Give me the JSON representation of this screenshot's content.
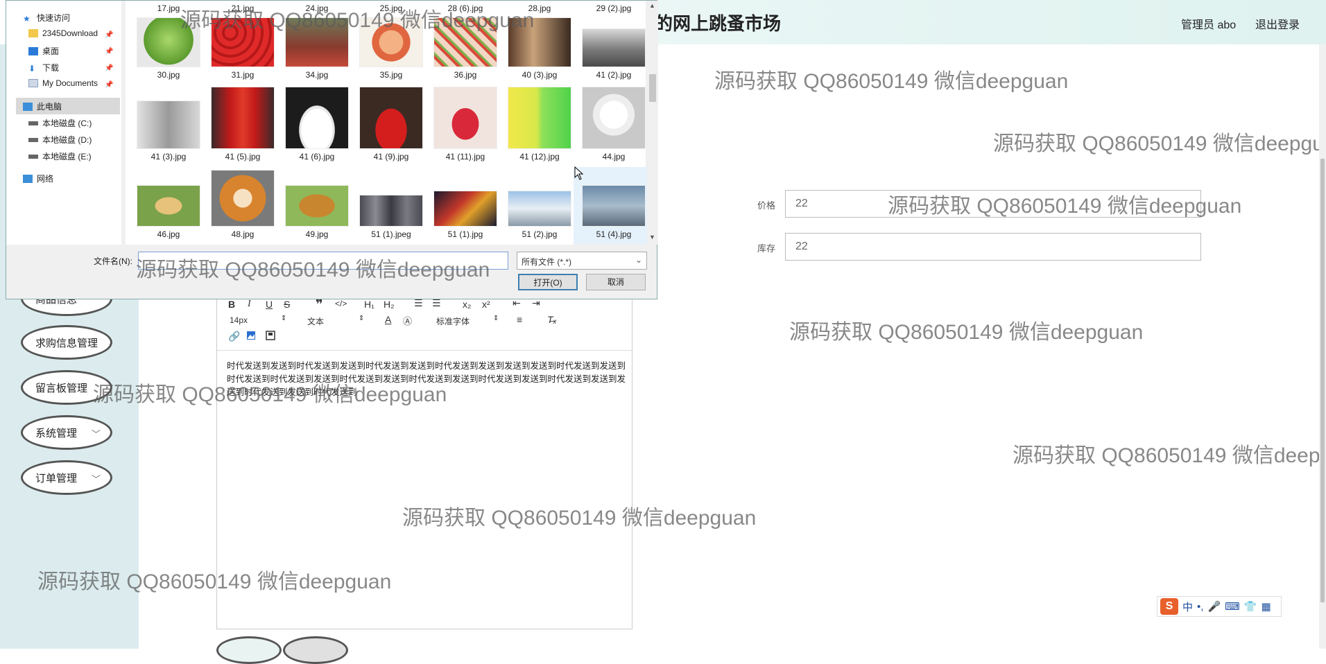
{
  "header": {
    "title": "的网上跳蚤市场",
    "user": "管理员 abo",
    "logout": "退出登录"
  },
  "sidebar": {
    "items": [
      {
        "label": "商品信息"
      },
      {
        "label": "求购信息管理"
      },
      {
        "label": "留言板管理"
      },
      {
        "label": "系统管理"
      },
      {
        "label": "订单管理"
      }
    ]
  },
  "form": {
    "price_label": "价格",
    "price_value": "22",
    "stock_label": "库存",
    "stock_value": "22"
  },
  "editor": {
    "font_size": "14px",
    "paragraph": "文本",
    "font_family": "标准字体",
    "content": "时代发送到发送到时代发送到发送到时代发送到发送到时代发送到发送到发送到发送到时代发送到发送到时代发送到时代发送到发送到时代发送到发送到时代发送到发送到时代发送到发送到时代发送到发送到发送到时代发送到发送到时代发送到"
  },
  "watermark": "源码获取 QQ86050149 微信deepguan",
  "dialog": {
    "nav": {
      "quick_access": "快速访问",
      "download_folder": "2345Download",
      "desktop": "桌面",
      "downloads": "下载",
      "my_documents": "My Documents",
      "this_pc": "此电脑",
      "drive_c": "本地磁盘 (C:)",
      "drive_d": "本地磁盘 (D:)",
      "drive_e": "本地磁盘 (E:)",
      "network": "网络"
    },
    "top_row": [
      "17.jpg",
      "21.jpg",
      "24.jpg",
      "25.jpg",
      "28 (6).jpg",
      "28.jpg",
      "29 (2).jpg"
    ],
    "rows": [
      [
        "30.jpg",
        "31.jpg",
        "34.jpg",
        "35.jpg",
        "36.jpg",
        "40 (3).jpg",
        "41 (2).jpg"
      ],
      [
        "41 (3).jpg",
        "41 (5).jpg",
        "41 (6).jpg",
        "41 (9).jpg",
        "41 (11).jpg",
        "41 (12).jpg",
        "44.jpg"
      ],
      [
        "46.jpg",
        "48.jpg",
        "49.jpg",
        "51 (1).jpeg",
        "51 (1).jpg",
        "51 (2).jpg",
        "51 (4).jpg"
      ]
    ],
    "filename_label": "文件名(N):",
    "filetype": "所有文件 (*.*)",
    "open_button": "打开(O)",
    "cancel_button": "取消"
  },
  "ime": {
    "lang": "中"
  },
  "colors": {
    "sidebar_bg": "#dcecee",
    "header_bg": "#e8f6f4",
    "dialog_bg": "#f0f0f0"
  }
}
